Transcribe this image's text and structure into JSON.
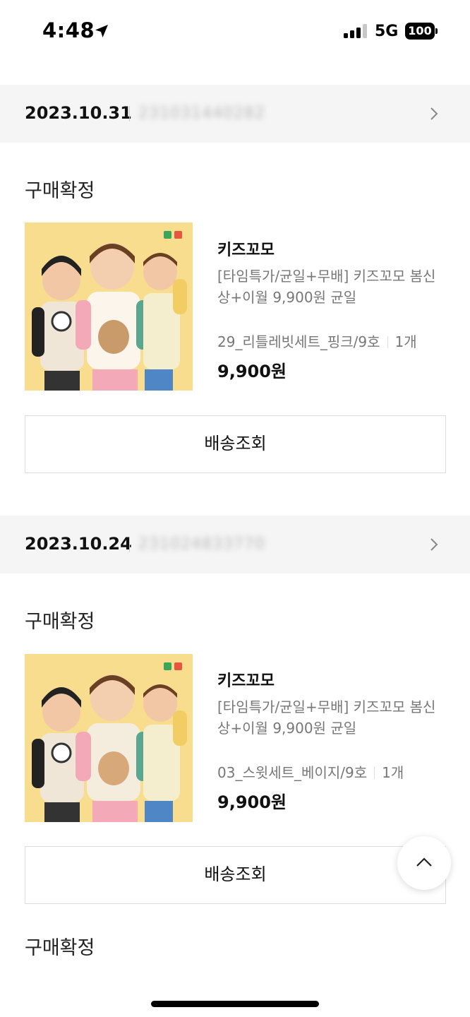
{
  "status_bar": {
    "time": "4:48",
    "network": "5G",
    "battery": "100",
    "icons": [
      "location-arrow-icon",
      "signal-icon",
      "battery-icon"
    ]
  },
  "orders": [
    {
      "date": "2023.10.31",
      "order_number": "231031440282",
      "status": "구매확정",
      "brand": "키즈꼬모",
      "product_name": "[타임특가/균일+무배] 키즈꼬모 봄신상+이월 9,900원 균일",
      "option": "29_리틀레빗세트_핑크/9호",
      "quantity": "1개",
      "price": "9,900원",
      "button": "배송조회"
    },
    {
      "date": "2023.10.24",
      "order_number": "231024833770",
      "status": "구매확정",
      "brand": "키즈꼬모",
      "product_name": "[타임특가/균일+무배] 키즈꼬모 봄신상+이월 9,900원 균일",
      "option": "03_스윗세트_베이지/9호",
      "quantity": "1개",
      "price": "9,900원",
      "button": "배송조회"
    }
  ],
  "third_status": "구매확정",
  "colors": {
    "header_bg": "#f5f5f5",
    "thumb_bg": "#f8dd8e",
    "muted_text": "#777777"
  }
}
